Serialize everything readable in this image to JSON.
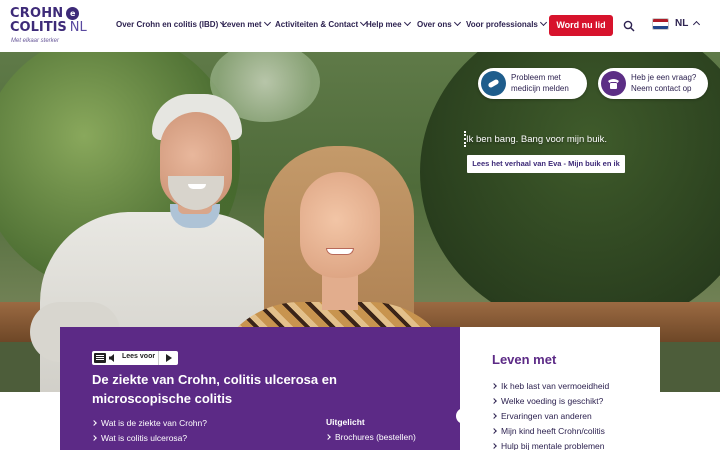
{
  "brand": {
    "line1": "CROHN",
    "badge": "e",
    "line2": "COLITIS",
    "suffix": "NL",
    "tagline": "Met elkaar sterker",
    "color": "#3d2a78"
  },
  "nav": {
    "items": [
      {
        "label": "Over Crohn en colitis (IBD)"
      },
      {
        "label": "Leven met"
      },
      {
        "label": "Activiteiten & Contact"
      },
      {
        "label": "Help mee"
      },
      {
        "label": "Over ons"
      },
      {
        "label": "Voor professionals"
      }
    ],
    "cta_label": "Word nu lid",
    "cta_color": "#d7132c",
    "search_icon": "search-icon",
    "language": "NL"
  },
  "hero": {
    "quick_links": [
      {
        "text_line1": "Probleem met",
        "text_line2": "medicijn melden",
        "icon": "pill-icon"
      },
      {
        "text_line1": "Heb je een vraag?",
        "text_line2": "Neem contact op",
        "icon": "phone-icon"
      }
    ],
    "quote": "Ik ben bang. Bang voor mijn buik.",
    "story_button": "Lees het verhaal van Eva - Mijn buik en ik"
  },
  "panel": {
    "readspeaker_label": "Lees voor",
    "title": "De ziekte van Crohn, colitis ulcerosa en microscopische colitis",
    "links": [
      "Wat is de ziekte van Crohn?",
      "Wat is colitis ulcerosa?"
    ],
    "uitgelicht_heading": "Uitgelicht",
    "uitgelicht_links": [
      "Brochures (bestellen)"
    ],
    "color": "#5c2a86"
  },
  "card": {
    "title": "Leven met",
    "links": [
      "Ik heb last van vermoeidheid",
      "Welke voeding is geschikt?",
      "Ervaringen van anderen",
      "Mijn kind heeft Crohn/colitis",
      "Hulp bij mentale problemen"
    ]
  }
}
